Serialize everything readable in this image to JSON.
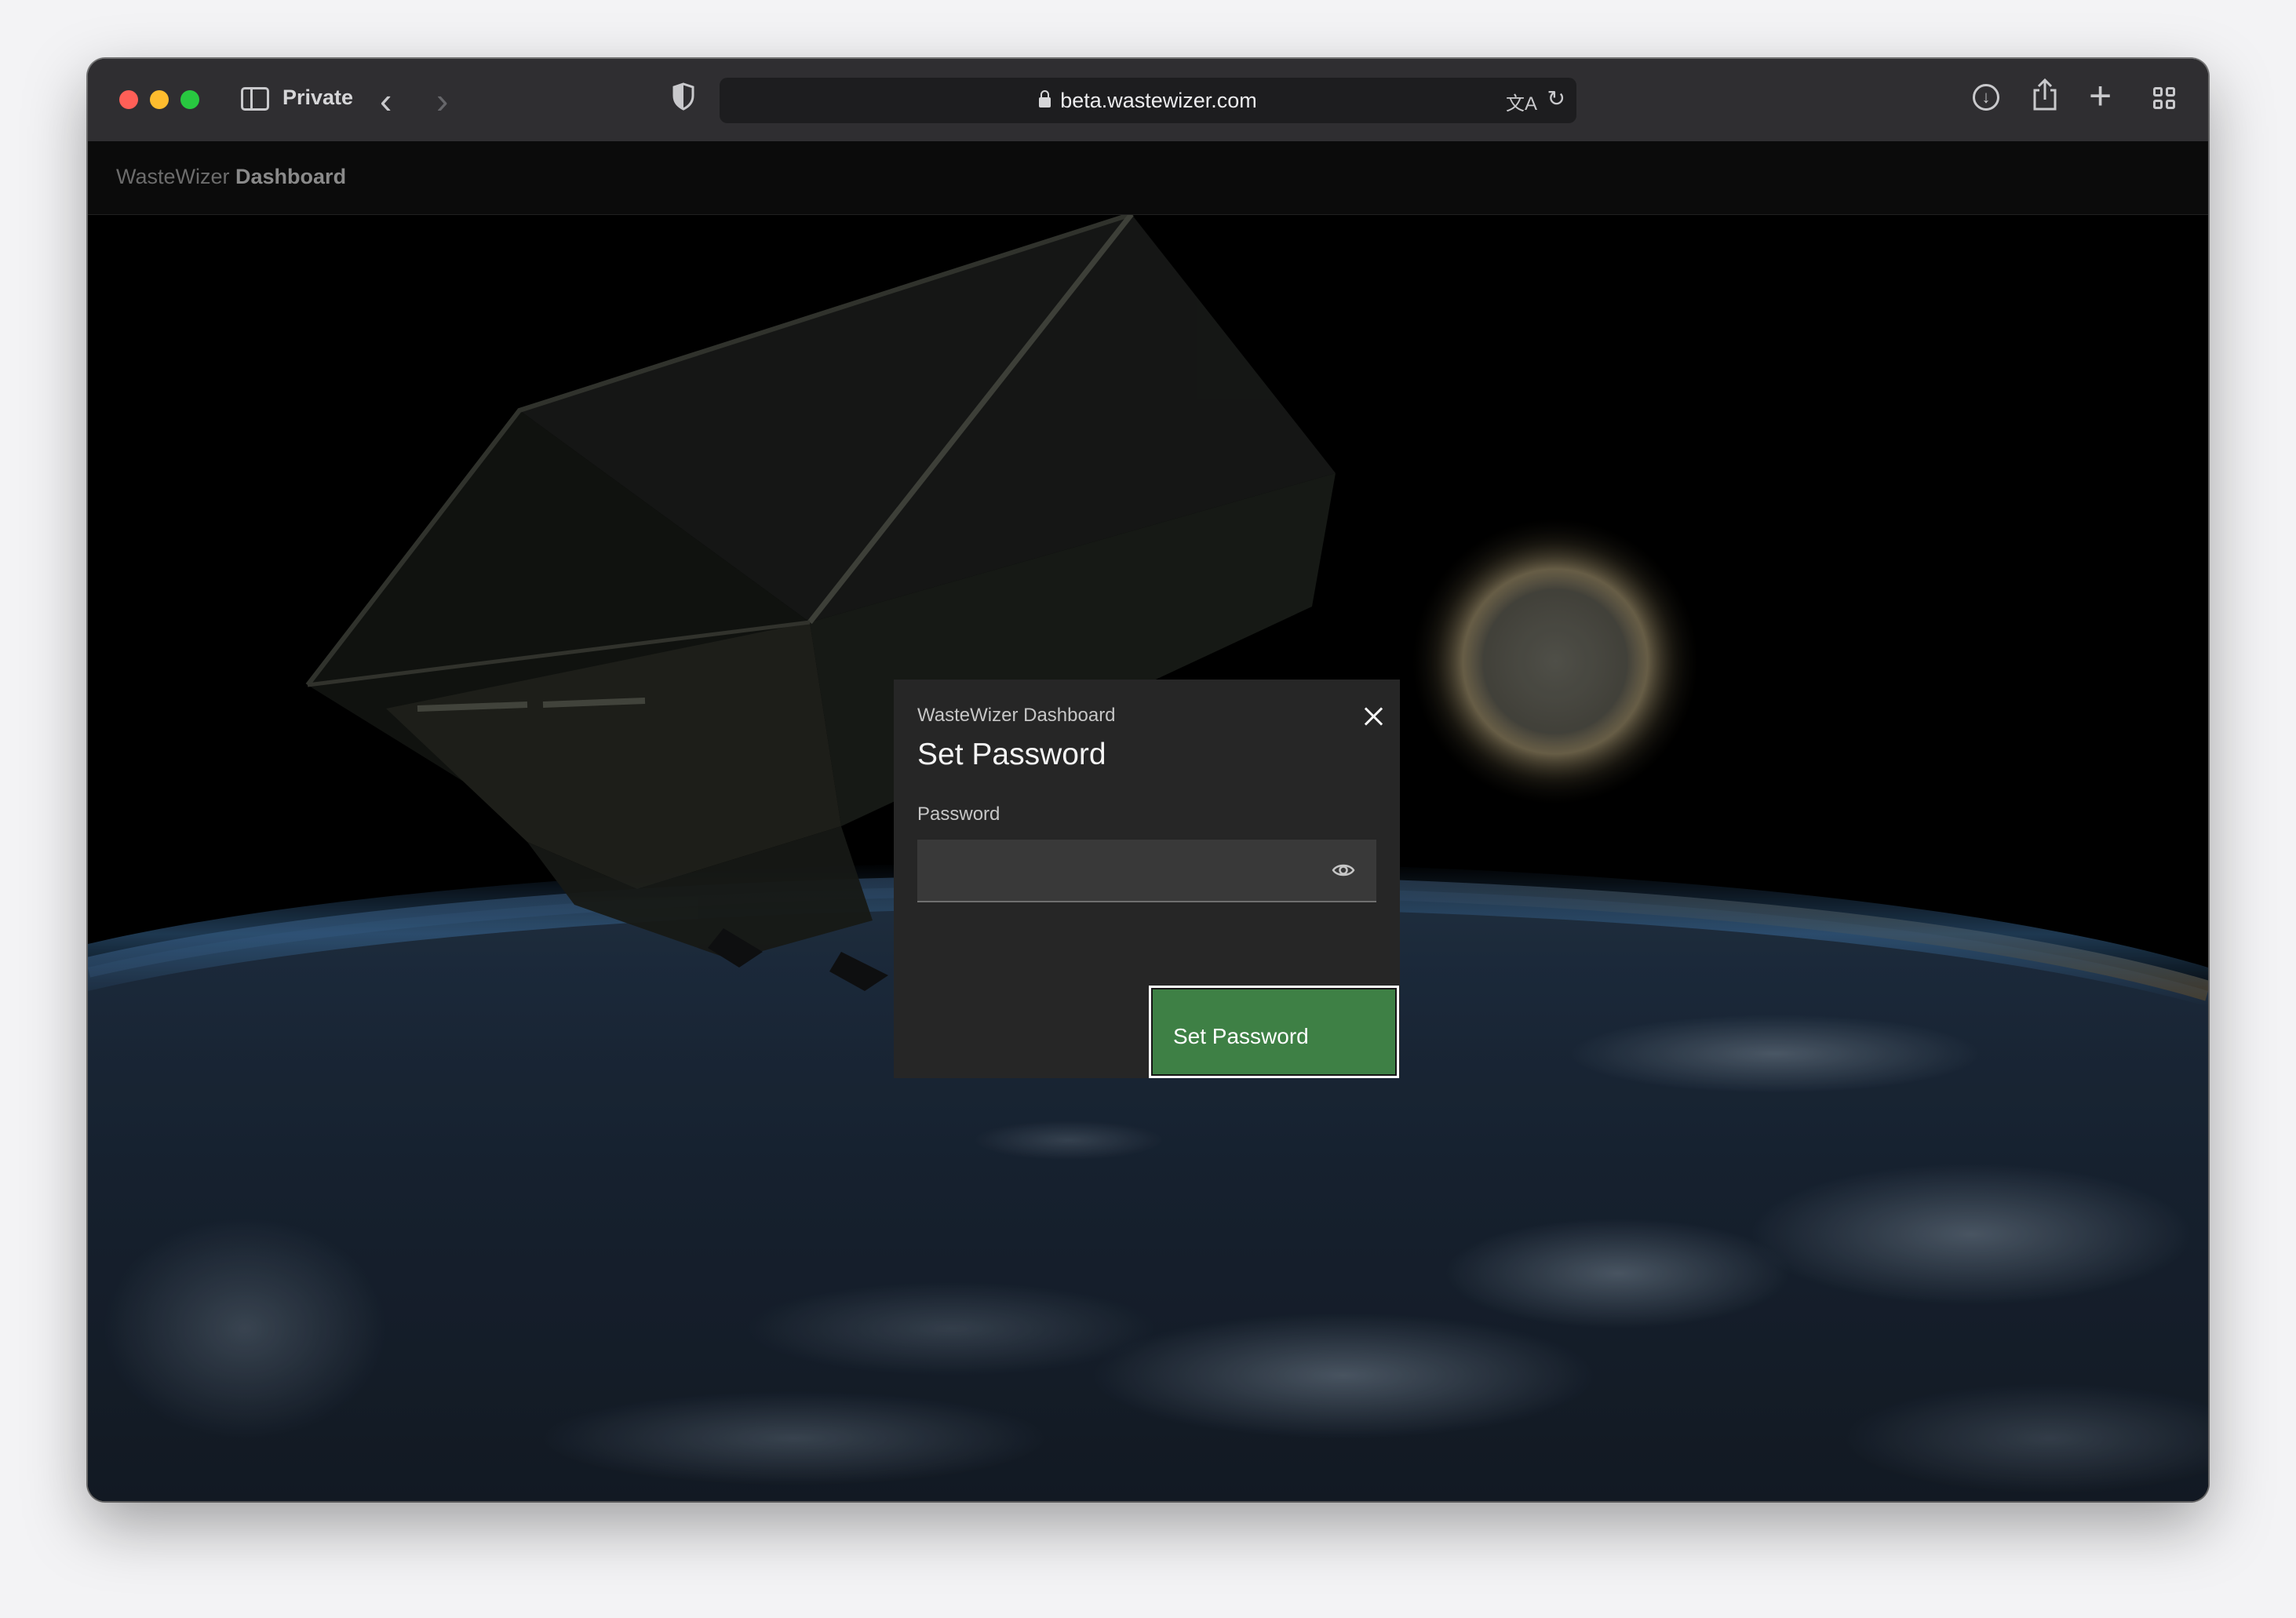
{
  "browser": {
    "mode_label": "Private",
    "url": "beta.wastewizer.com"
  },
  "app": {
    "brand_prefix": "WasteWizer",
    "brand_suffix": "Dashboard"
  },
  "modal": {
    "label": "WasteWizer Dashboard",
    "title": "Set Password",
    "password_label": "Password",
    "password_value": "",
    "submit_label": "Set Password"
  },
  "colors": {
    "primary_button": "#3e8045",
    "modal_bg": "#262626",
    "input_bg": "#393939",
    "toolbar_bg": "#2f2e31"
  },
  "icons": [
    "sidebar-icon",
    "back-icon",
    "forward-icon",
    "shield-icon",
    "lock-icon",
    "translate-icon",
    "reload-icon",
    "download-icon",
    "share-icon",
    "new-tab-icon",
    "tab-overview-icon",
    "close-icon",
    "eye-icon"
  ]
}
